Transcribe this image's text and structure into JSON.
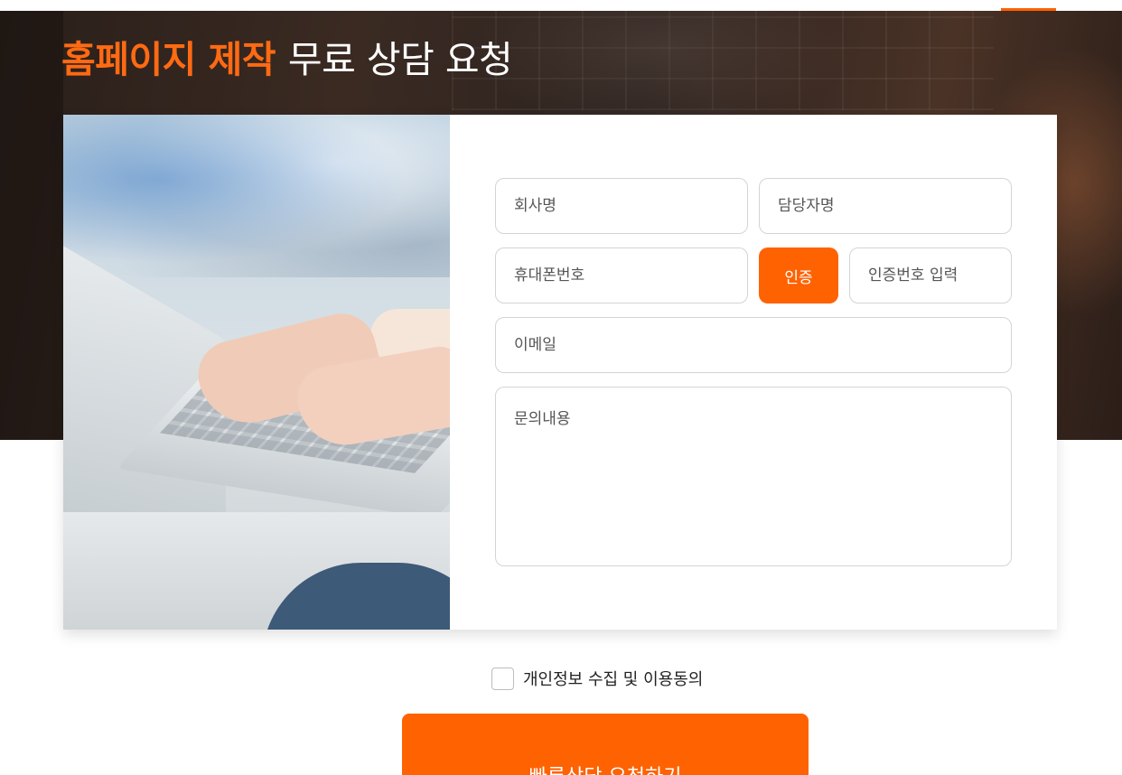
{
  "header": {
    "title_accent": "홈페이지 제작",
    "title_rest": "무료 상담 요청"
  },
  "form": {
    "company_placeholder": "회사명",
    "contact_name_placeholder": "담당자명",
    "phone_placeholder": "휴대폰번호",
    "verify_label": "인증",
    "verify_code_placeholder": "인증번호 입력",
    "email_placeholder": "이메일",
    "inquiry_placeholder": "문의내용"
  },
  "consent": {
    "label": "개인정보 수집 및 이용동의",
    "checked": false
  },
  "submit": {
    "label": "빠른상담 요청하기"
  },
  "colors": {
    "accent": "#ff6200",
    "title_accent": "#ff6a13",
    "border": "#d4d4d4"
  }
}
